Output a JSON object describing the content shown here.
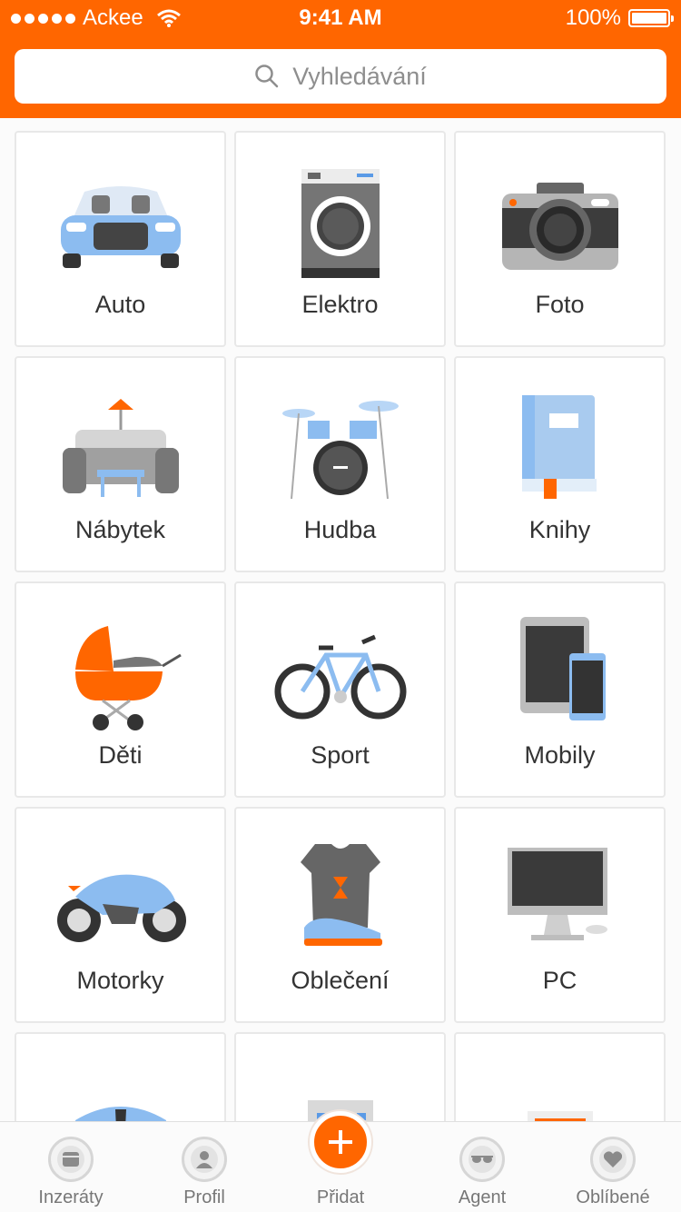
{
  "status_bar": {
    "carrier": "Ackee",
    "time": "9:41 AM",
    "battery": "100%"
  },
  "search": {
    "placeholder": "Vyhledávání",
    "icon": "search-icon"
  },
  "categories": [
    {
      "label": "Auto",
      "icon": "car-icon"
    },
    {
      "label": "Elektro",
      "icon": "washing-machine-icon"
    },
    {
      "label": "Foto",
      "icon": "camera-icon"
    },
    {
      "label": "Nábytek",
      "icon": "sofa-icon"
    },
    {
      "label": "Hudba",
      "icon": "drums-icon"
    },
    {
      "label": "Knihy",
      "icon": "book-icon"
    },
    {
      "label": "Děti",
      "icon": "stroller-icon"
    },
    {
      "label": "Sport",
      "icon": "bicycle-icon"
    },
    {
      "label": "Mobily",
      "icon": "tablet-phone-icon"
    },
    {
      "label": "Motorky",
      "icon": "motorcycle-icon"
    },
    {
      "label": "Oblečení",
      "icon": "clothing-icon"
    },
    {
      "label": "PC",
      "icon": "computer-icon"
    },
    {
      "label": "",
      "icon": "jobs-icon"
    },
    {
      "label": "",
      "icon": "building-icon"
    },
    {
      "label": "",
      "icon": "document-icon"
    }
  ],
  "tabbar": {
    "items": [
      {
        "label": "Inzeráty",
        "icon": "listings-icon"
      },
      {
        "label": "Profil",
        "icon": "profile-icon"
      },
      {
        "label": "Přidat",
        "icon": "add-icon"
      },
      {
        "label": "Agent",
        "icon": "agent-icon"
      },
      {
        "label": "Oblíbené",
        "icon": "heart-icon"
      }
    ]
  },
  "colors": {
    "accent": "#ff6600",
    "tile_border": "#e8e8e8",
    "text": "#333333",
    "tab_label": "#777777"
  }
}
